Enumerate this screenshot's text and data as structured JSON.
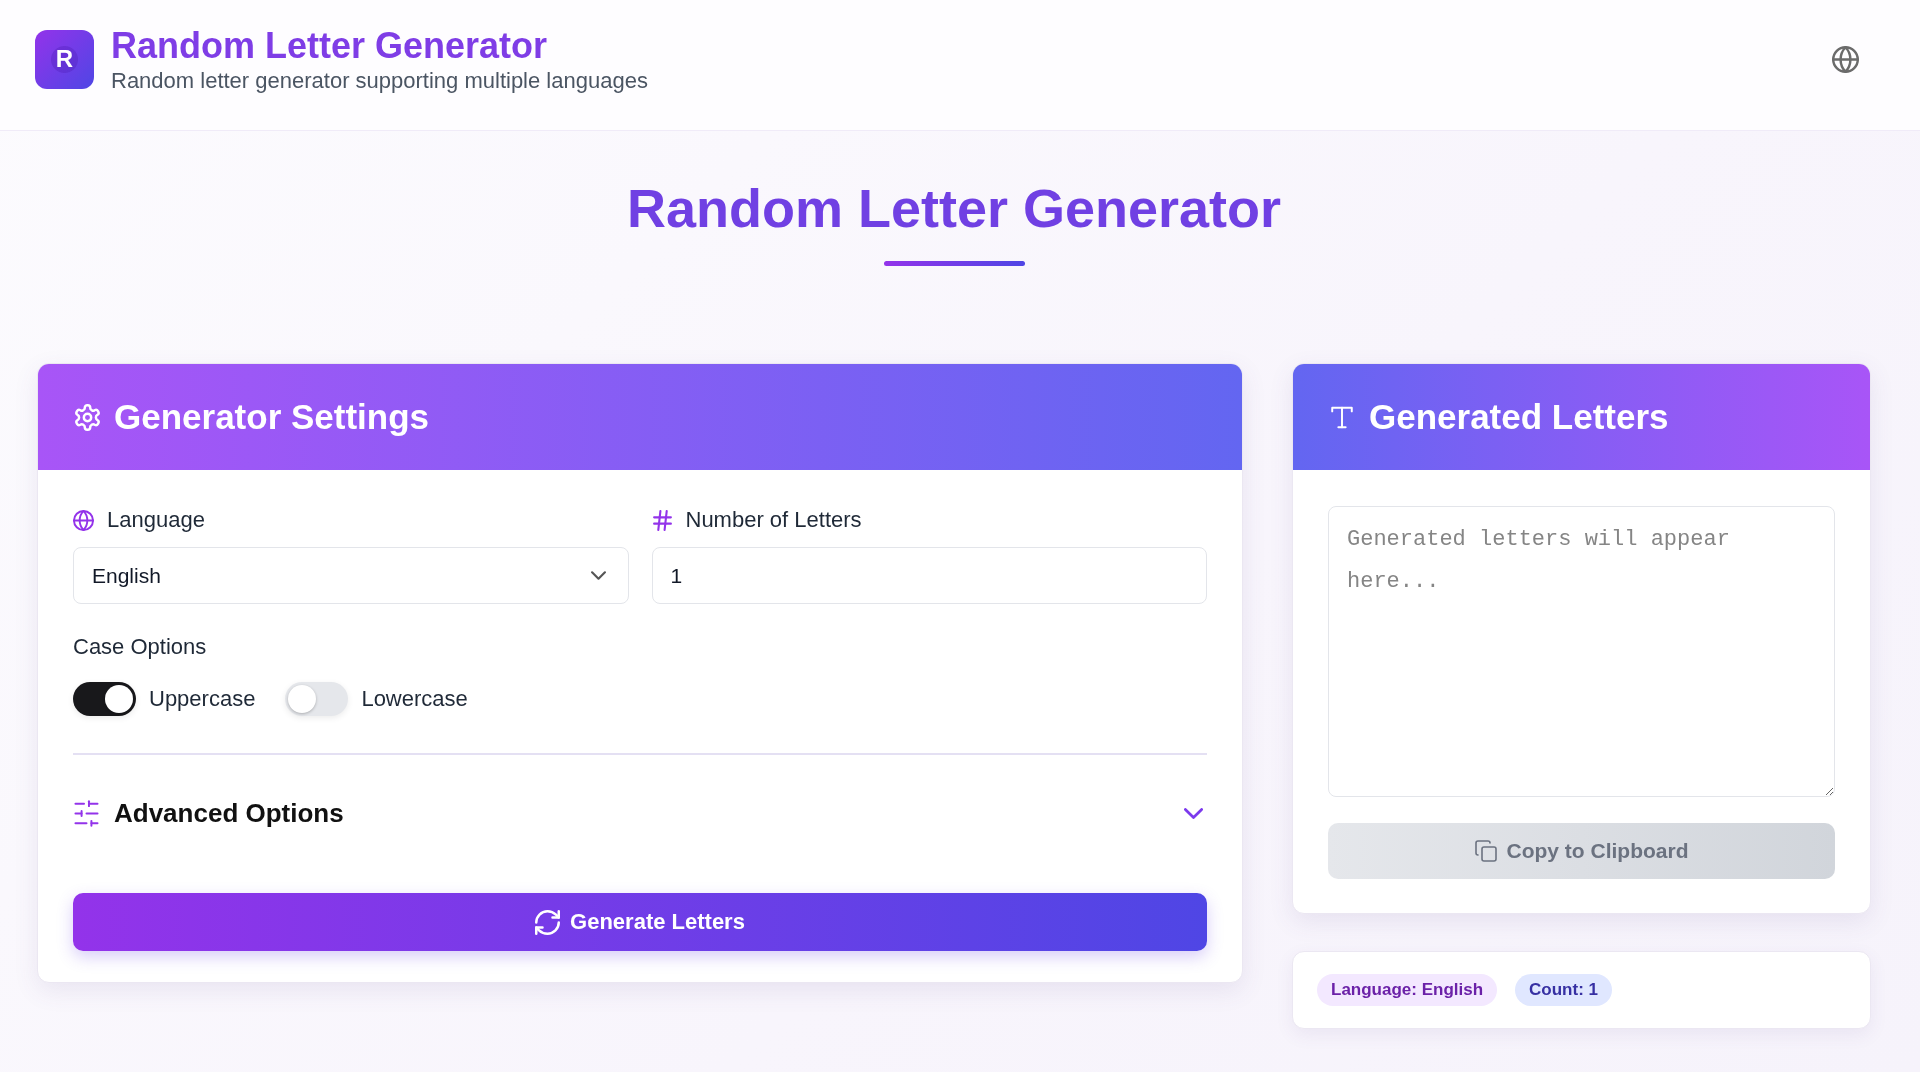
{
  "header": {
    "logo_letter": "R",
    "title": "Random Letter Generator",
    "subtitle": "Random letter generator supporting multiple languages"
  },
  "hero": {
    "title": "Random Letter Generator"
  },
  "settings": {
    "title": "Generator Settings",
    "fields": [
      {
        "kind": "select",
        "label": "Language",
        "value": "English"
      },
      {
        "kind": "number",
        "label": "Number of Letters",
        "value": "1"
      }
    ],
    "case_options": {
      "label": "Case Options",
      "toggles": [
        {
          "label": "Uppercase",
          "on": true
        },
        {
          "label": "Lowercase",
          "on": false
        }
      ]
    },
    "advanced_options": {
      "title": "Advanced Options",
      "expanded": false
    },
    "generate_button": {
      "label": "Generate Letters"
    }
  },
  "output": {
    "title": "Generated Letters",
    "textarea": {
      "placeholder": "Generated letters will appear here..."
    },
    "copy_button": {
      "label": "Copy to Clipboard",
      "disabled": true
    }
  },
  "stats": {
    "badges": [
      {
        "label": "Language: English",
        "color": "#f3e8ff"
      },
      {
        "label": "Count: 1",
        "color": "#e0e7ff"
      }
    ]
  }
}
